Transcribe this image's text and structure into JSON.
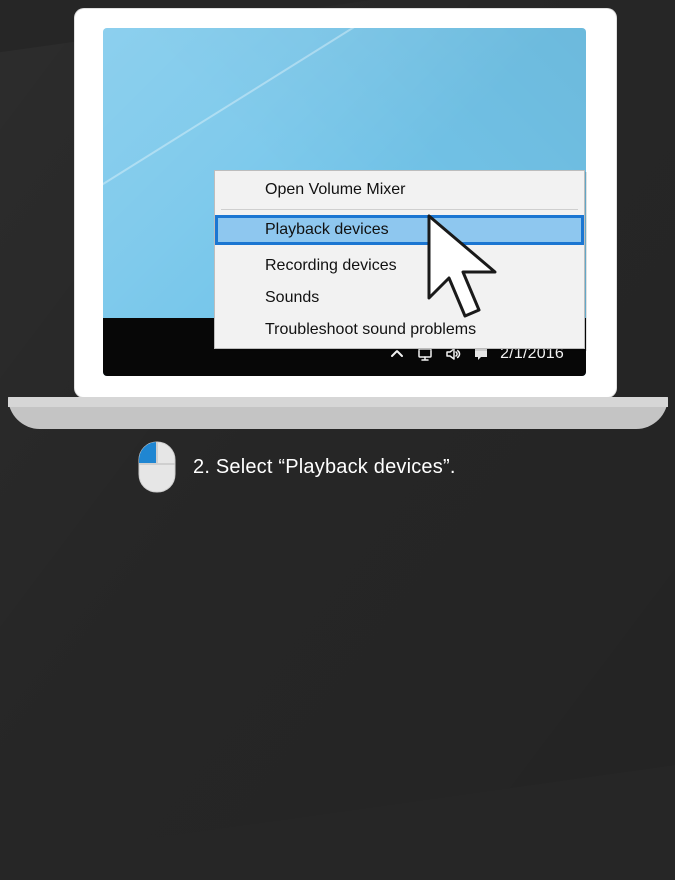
{
  "context_menu": {
    "items": [
      {
        "label": "Open Volume Mixer",
        "selected": false
      },
      {
        "label": "Playback devices",
        "selected": true
      },
      {
        "label": "Recording devices",
        "selected": false
      },
      {
        "label": "Sounds",
        "selected": false
      },
      {
        "label": "Troubleshoot sound problems",
        "selected": false
      }
    ]
  },
  "taskbar": {
    "date": "2/1/2016",
    "icons": [
      "chevron-up-icon",
      "network-icon",
      "volume-icon",
      "message-icon"
    ]
  },
  "instruction": {
    "step_text": "2.  Select “Playback devices”.",
    "icon": "mouse-left-click-icon"
  },
  "colors": {
    "desktop_blue": "#73c5ea",
    "selection_fill": "#8ec7ef",
    "selection_border": "#1b76d2",
    "taskbar": "#070707"
  }
}
